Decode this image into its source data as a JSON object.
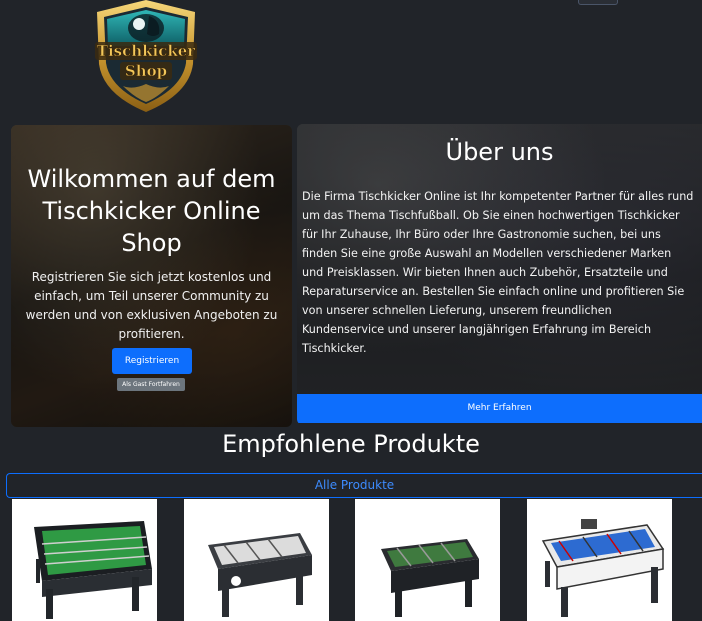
{
  "header": {
    "logo_text_line1": "Tischkicker",
    "logo_text_line2": "Shop"
  },
  "welcome": {
    "title": "Wilkommen auf dem Tischkicker Online Shop",
    "text": "Registrieren Sie sich jetzt kostenlos und einfach, um Teil unserer Community zu werden und von exklusiven Angeboten zu profitieren.",
    "register_label": "Registrieren",
    "guest_label": "Als Gast Fortfahren"
  },
  "about": {
    "title": "Über uns",
    "text": "Die Firma Tischkicker Online ist Ihr kompetenter Partner für alles rund um das Thema Tischfußball. Ob Sie einen hochwertigen Tischkicker für Ihr Zuhause, Ihr Büro oder Ihre Gastronomie suchen, bei uns finden Sie eine große Auswahl an Modellen verschiedener Marken und Preisklassen. Wir bieten Ihnen auch Zubehör, Ersatzteile und Reparaturservice an. Bestellen Sie einfach online und profitieren Sie von unserer schnellen Lieferung, unserem freundlichen Kundenservice und unserer langjährigen Erfahrung im Bereich Tischkicker.",
    "more_label": "Mehr Erfahren"
  },
  "products": {
    "title": "Empfohlene Produkte",
    "all_label": "Alle Produkte"
  },
  "colors": {
    "background": "#212429",
    "primary": "#0d6efd",
    "secondary": "#6c757d"
  }
}
